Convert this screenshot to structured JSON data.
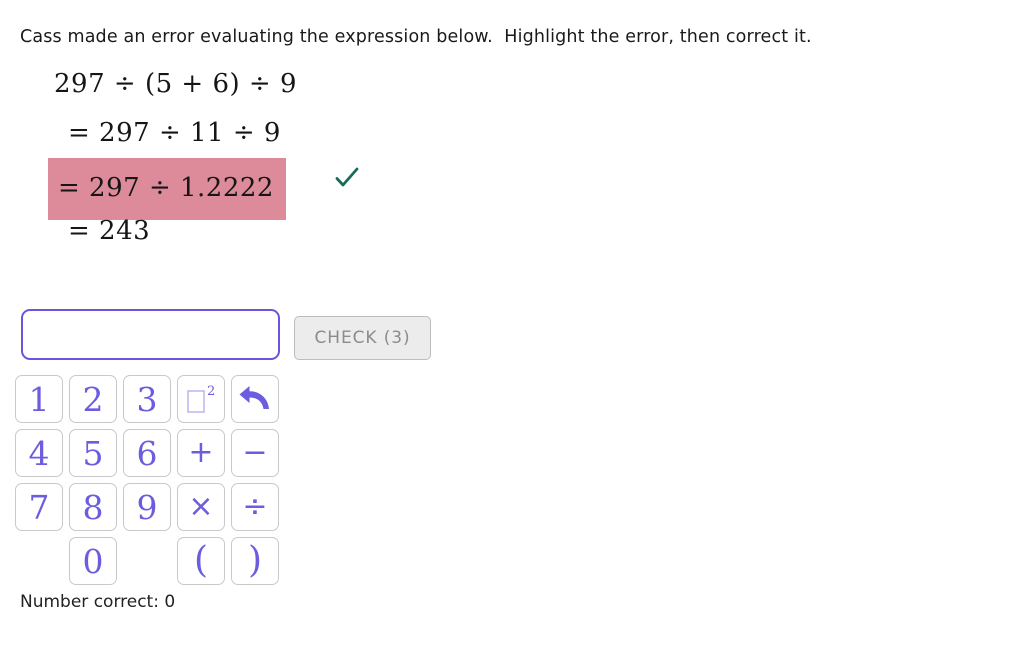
{
  "prompt": "Cass made an error evaluating the expression below.  Highlight the error, then correct it.",
  "work": {
    "lines": [
      {
        "text": "297 ÷ (5 + 6) ÷ 9",
        "highlighted": false
      },
      {
        "text": "= 297 ÷ 11 ÷ 9",
        "highlighted": false
      },
      {
        "text": "= 297 ÷ 1.2222",
        "highlighted": true
      },
      {
        "text": "= 243",
        "highlighted": false
      }
    ],
    "highlight_color": "#dd8a9b",
    "check_mark_color": "#1a6b5a"
  },
  "answer": {
    "input_value": "",
    "input_placeholder": "",
    "input_border_color": "#6a55e0",
    "check_button_label": "CHECK (3)"
  },
  "keypad": {
    "accent_color": "#6c5ce0",
    "keys": [
      {
        "label": "1",
        "name": "key-1",
        "type": "digit"
      },
      {
        "label": "2",
        "name": "key-2",
        "type": "digit"
      },
      {
        "label": "3",
        "name": "key-3",
        "type": "digit"
      },
      {
        "label": "",
        "name": "key-exponent-square",
        "type": "exponent"
      },
      {
        "label": "",
        "name": "key-undo",
        "type": "undo"
      },
      {
        "label": "4",
        "name": "key-4",
        "type": "digit"
      },
      {
        "label": "5",
        "name": "key-5",
        "type": "digit"
      },
      {
        "label": "6",
        "name": "key-6",
        "type": "digit"
      },
      {
        "label": "+",
        "name": "key-plus",
        "type": "op"
      },
      {
        "label": "−",
        "name": "key-minus",
        "type": "op"
      },
      {
        "label": "7",
        "name": "key-7",
        "type": "digit"
      },
      {
        "label": "8",
        "name": "key-8",
        "type": "digit"
      },
      {
        "label": "9",
        "name": "key-9",
        "type": "digit"
      },
      {
        "label": "×",
        "name": "key-multiply",
        "type": "op"
      },
      {
        "label": "÷",
        "name": "key-divide",
        "type": "op"
      },
      {
        "label": "",
        "name": "key-blank-1",
        "type": "blank"
      },
      {
        "label": "0",
        "name": "key-0",
        "type": "digit"
      },
      {
        "label": "",
        "name": "key-blank-2",
        "type": "blank"
      },
      {
        "label": "(",
        "name": "key-open-paren",
        "type": "paren"
      },
      {
        "label": ")",
        "name": "key-close-paren",
        "type": "paren"
      }
    ],
    "exponent_superscript": "2"
  },
  "footer": {
    "score_text": "Number correct: 0"
  }
}
